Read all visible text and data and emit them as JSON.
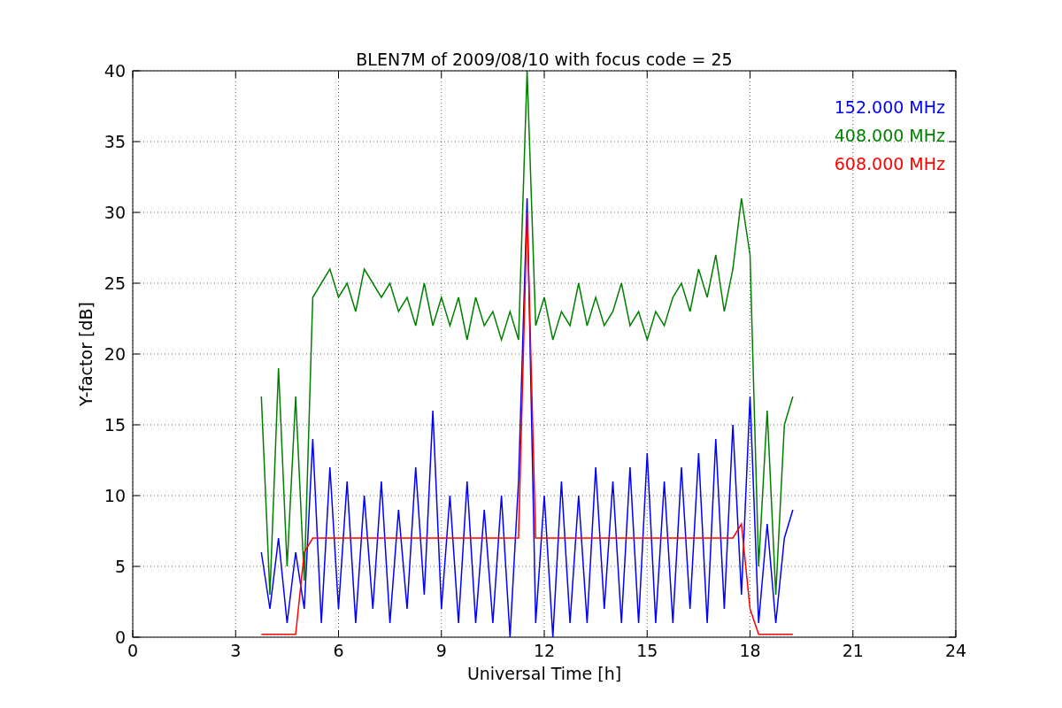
{
  "figure": {
    "chart_data": {
      "type": "line",
      "title": "BLEN7M of 2009/08/10 with focus code = 25",
      "xlabel": "Universal Time [h]",
      "ylabel": "Y-factor [dB]",
      "x": [
        3.75,
        4,
        4.25,
        4.5,
        4.75,
        5,
        5.25,
        5.5,
        5.75,
        6,
        6.25,
        6.5,
        6.75,
        7,
        7.25,
        7.5,
        7.75,
        8,
        8.25,
        8.5,
        8.75,
        9,
        9.25,
        9.5,
        9.75,
        10,
        10.25,
        10.5,
        10.75,
        11,
        11.25,
        11.5,
        11.75,
        12,
        12.25,
        12.5,
        12.75,
        13,
        13.25,
        13.5,
        13.75,
        14,
        14.25,
        14.5,
        14.75,
        15,
        15.25,
        15.5,
        15.75,
        16,
        16.25,
        16.5,
        16.75,
        17,
        17.25,
        17.5,
        17.75,
        18,
        18.25,
        18.5,
        18.75,
        19,
        19.25
      ],
      "series": [
        {
          "name": "152.000 MHz",
          "color": "#0000ff",
          "values": [
            6,
            2,
            7,
            1,
            6,
            2,
            14,
            1,
            12,
            2,
            11,
            1,
            10,
            2,
            11,
            1,
            9,
            2,
            12,
            3,
            16,
            2,
            10,
            1,
            11,
            1,
            9,
            1,
            10,
            0,
            11,
            31,
            1,
            10,
            0,
            11,
            1,
            10,
            1,
            12,
            2,
            11,
            1,
            12,
            1,
            13,
            1,
            11,
            1,
            12,
            2,
            13,
            1,
            14,
            2,
            15,
            3,
            17,
            1,
            8,
            1,
            7,
            9
          ]
        },
        {
          "name": "408.000 MHz",
          "color": "#008000",
          "values": [
            17,
            3,
            19,
            5,
            17,
            4,
            24,
            25,
            26,
            24,
            25,
            23,
            26,
            25,
            24,
            25,
            23,
            24,
            22,
            25,
            22,
            24,
            22,
            24,
            21,
            24,
            22,
            23,
            21,
            23,
            21,
            40,
            22,
            24,
            21,
            23,
            22,
            25,
            22,
            24,
            22,
            23,
            25,
            22,
            23,
            21,
            23,
            22,
            24,
            25,
            23,
            26,
            24,
            27,
            23,
            26,
            31,
            27,
            5,
            16,
            3,
            15,
            17
          ]
        },
        {
          "name": "608.000 MHz",
          "color": "#ff0000",
          "values": [
            0.2,
            0.2,
            0.2,
            0.2,
            0.2,
            6,
            7,
            7,
            7,
            7,
            7,
            7,
            7,
            7,
            7,
            7,
            7,
            7,
            7,
            7,
            7,
            7,
            7,
            7,
            7,
            7,
            7,
            7,
            7,
            7,
            7,
            30,
            7,
            7,
            7,
            7,
            7,
            7,
            7,
            7,
            7,
            7,
            7,
            7,
            7,
            7,
            7,
            7,
            7,
            7,
            7,
            7,
            7,
            7,
            7,
            7,
            8,
            2,
            0.2,
            0.2,
            0.2,
            0.2,
            0.2
          ]
        }
      ],
      "grid": true,
      "xlim": [
        0,
        24
      ],
      "ylim": [
        0,
        40
      ],
      "xticks": [
        0,
        3,
        6,
        9,
        12,
        15,
        18,
        21,
        24
      ],
      "yticks": [
        0,
        5,
        10,
        15,
        20,
        25,
        30,
        35,
        40
      ]
    }
  }
}
